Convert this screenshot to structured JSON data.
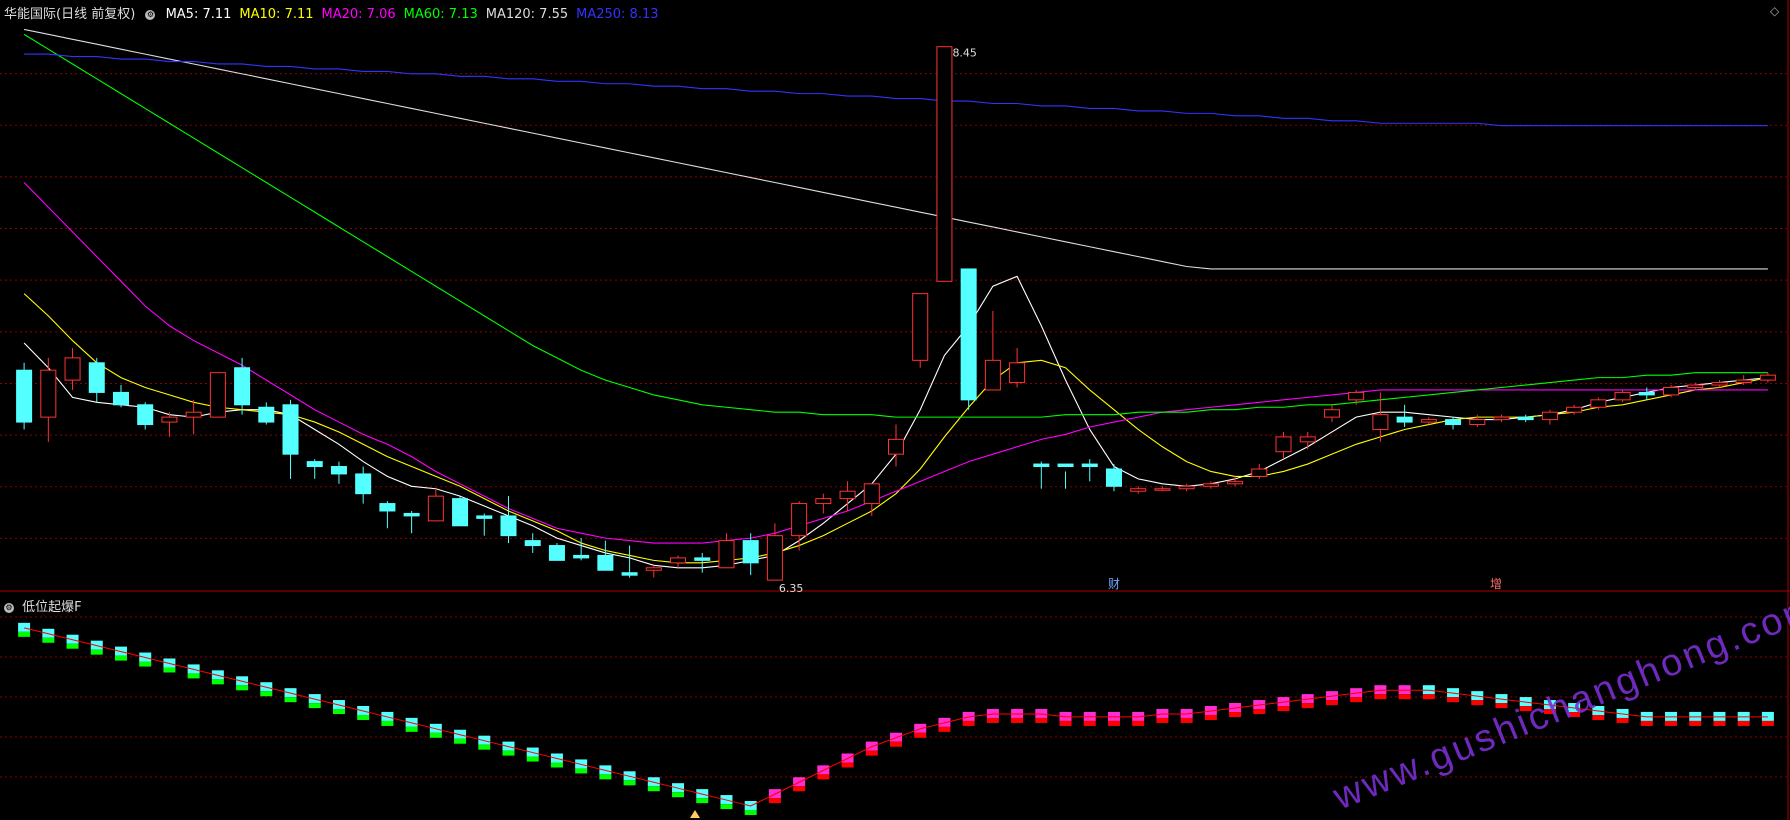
{
  "header": {
    "stock": "华能国际(日线 前复权)",
    "ma_labels": [
      {
        "name": "MA5",
        "text": "MA5: 7.11",
        "color": "#ffffff"
      },
      {
        "name": "MA10",
        "text": "MA10: 7.11",
        "color": "#ffff00"
      },
      {
        "name": "MA20",
        "text": "MA20: 7.06",
        "color": "#ff00ff"
      },
      {
        "name": "MA60",
        "text": "MA60: 7.13",
        "color": "#00ff00"
      },
      {
        "name": "MA120",
        "text": "MA120: 7.55",
        "color": "#dddddd"
      },
      {
        "name": "MA250",
        "text": "MA250: 8.13",
        "color": "#3333ff"
      }
    ]
  },
  "indicator": {
    "title": "低位起爆F"
  },
  "watermark": "www.gushichanghong.com",
  "annotations": {
    "high_label": "8.45",
    "low_label": "6.35",
    "event1": "财",
    "event2": "增"
  },
  "colors": {
    "up": "#ff3232",
    "down": "#54ffff",
    "grid": "#8b0000",
    "bg": "#000000"
  },
  "chart_data": {
    "type": "candlestick",
    "ylim": [
      6.25,
      8.55
    ],
    "candles": [
      [
        7.14,
        6.93,
        7.17,
        6.9
      ],
      [
        6.95,
        7.14,
        7.19,
        6.85
      ],
      [
        7.1,
        7.19,
        7.23,
        7.06
      ],
      [
        7.17,
        7.05,
        7.19,
        7.01
      ],
      [
        7.05,
        7.0,
        7.08,
        6.99
      ],
      [
        7.0,
        6.92,
        7.01,
        6.9
      ],
      [
        6.93,
        6.95,
        6.97,
        6.87
      ],
      [
        6.95,
        6.97,
        7.02,
        6.88
      ],
      [
        6.95,
        7.13,
        7.13,
        6.95
      ],
      [
        7.15,
        7.0,
        7.19,
        6.96
      ],
      [
        6.99,
        6.93,
        7.01,
        6.92
      ],
      [
        7.0,
        6.8,
        7.02,
        6.7
      ],
      [
        6.77,
        6.75,
        6.78,
        6.7
      ],
      [
        6.75,
        6.72,
        6.77,
        6.68
      ],
      [
        6.72,
        6.64,
        6.75,
        6.6
      ],
      [
        6.6,
        6.57,
        6.61,
        6.5
      ],
      [
        6.56,
        6.55,
        6.57,
        6.48
      ],
      [
        6.53,
        6.63,
        6.66,
        6.53
      ],
      [
        6.62,
        6.51,
        6.63,
        6.51
      ],
      [
        6.55,
        6.54,
        6.56,
        6.47
      ],
      [
        6.55,
        6.47,
        6.63,
        6.44
      ],
      [
        6.45,
        6.43,
        6.48,
        6.4
      ],
      [
        6.43,
        6.37,
        6.44,
        6.38
      ],
      [
        6.39,
        6.38,
        6.46,
        6.37
      ],
      [
        6.39,
        6.33,
        6.45,
        6.38
      ],
      [
        6.32,
        6.31,
        6.43,
        6.3
      ],
      [
        6.33,
        6.34,
        6.35,
        6.3
      ],
      [
        6.36,
        6.38,
        6.39,
        6.34
      ],
      [
        6.38,
        6.37,
        6.4,
        6.32
      ],
      [
        6.34,
        6.45,
        6.48,
        6.34
      ],
      [
        6.45,
        6.36,
        6.48,
        6.31
      ],
      [
        6.29,
        6.47,
        6.52,
        6.29
      ],
      [
        6.47,
        6.6,
        6.61,
        6.41
      ],
      [
        6.6,
        6.62,
        6.64,
        6.56
      ],
      [
        6.62,
        6.65,
        6.69,
        6.57
      ],
      [
        6.6,
        6.68,
        6.68,
        6.55
      ],
      [
        6.8,
        6.86,
        6.92,
        6.75
      ],
      [
        7.18,
        7.45,
        7.4,
        7.15
      ],
      [
        7.5,
        8.45,
        8.45,
        7.9
      ],
      [
        7.55,
        7.02,
        7.55,
        6.98
      ],
      [
        7.06,
        7.18,
        7.38,
        7.06
      ],
      [
        7.09,
        7.17,
        7.23,
        7.07
      ],
      [
        6.76,
        6.75,
        6.77,
        6.66
      ],
      [
        6.76,
        6.75,
        6.73,
        6.66
      ],
      [
        6.76,
        6.75,
        6.78,
        6.69
      ],
      [
        6.74,
        6.67,
        6.76,
        6.65
      ],
      [
        6.65,
        6.66,
        6.67,
        6.64
      ],
      [
        6.66,
        6.66,
        6.67,
        6.65
      ],
      [
        6.66,
        6.67,
        6.68,
        6.65
      ],
      [
        6.67,
        6.68,
        6.69,
        6.66
      ],
      [
        6.68,
        6.69,
        6.71,
        6.67
      ],
      [
        6.71,
        6.74,
        6.76,
        6.7
      ],
      [
        6.81,
        6.87,
        6.89,
        6.78
      ],
      [
        6.85,
        6.87,
        6.89,
        6.82
      ],
      [
        6.95,
        6.98,
        7.0,
        6.93
      ],
      [
        7.02,
        7.05,
        7.06,
        7.0
      ],
      [
        6.9,
        6.96,
        7.05,
        6.85
      ],
      [
        6.95,
        6.93,
        7.0,
        6.91
      ],
      [
        6.93,
        6.94,
        6.95,
        6.92
      ],
      [
        6.94,
        6.92,
        6.95,
        6.9
      ],
      [
        6.92,
        6.94,
        6.96,
        6.91
      ],
      [
        6.94,
        6.95,
        6.96,
        6.93
      ],
      [
        6.95,
        6.94,
        6.96,
        6.93
      ],
      [
        6.94,
        6.97,
        6.98,
        6.92
      ],
      [
        6.97,
        6.99,
        7.0,
        6.96
      ],
      [
        6.99,
        7.02,
        7.03,
        6.98
      ],
      [
        7.02,
        7.05,
        7.06,
        7.01
      ],
      [
        7.05,
        7.04,
        7.07,
        7.02
      ],
      [
        7.04,
        7.07,
        7.08,
        7.03
      ],
      [
        7.07,
        7.08,
        7.09,
        7.06
      ],
      [
        7.08,
        7.09,
        7.1,
        7.07
      ],
      [
        7.09,
        7.1,
        7.12,
        7.08
      ],
      [
        7.1,
        7.12,
        7.13,
        7.09
      ]
    ],
    "ma": {
      "MA5": [
        7.25,
        7.15,
        7.03,
        7.01,
        7.0,
        6.99,
        6.96,
        6.95,
        6.97,
        6.98,
        6.98,
        6.96,
        6.9,
        6.84,
        6.77,
        6.71,
        6.67,
        6.66,
        6.63,
        6.59,
        6.55,
        6.51,
        6.46,
        6.43,
        6.4,
        6.38,
        6.35,
        6.34,
        6.34,
        6.35,
        6.37,
        6.39,
        6.45,
        6.52,
        6.6,
        6.68,
        6.8,
        6.98,
        7.2,
        7.32,
        7.48,
        7.52,
        7.32,
        7.1,
        6.9,
        6.75,
        6.7,
        6.68,
        6.67,
        6.68,
        6.7,
        6.73,
        6.78,
        6.83,
        6.89,
        6.95,
        6.97,
        6.97,
        6.96,
        6.95,
        6.94,
        6.94,
        6.95,
        6.96,
        6.98,
        7.01,
        7.03,
        7.05,
        7.07,
        7.08,
        7.09,
        7.1,
        7.11
      ],
      "MA10": [
        7.45,
        7.36,
        7.26,
        7.17,
        7.11,
        7.07,
        7.04,
        7.01,
        6.99,
        6.98,
        6.97,
        6.96,
        6.93,
        6.89,
        6.84,
        6.79,
        6.75,
        6.71,
        6.67,
        6.62,
        6.57,
        6.53,
        6.49,
        6.44,
        6.41,
        6.39,
        6.37,
        6.36,
        6.36,
        6.37,
        6.38,
        6.4,
        6.43,
        6.47,
        6.52,
        6.57,
        6.64,
        6.74,
        6.87,
        6.99,
        7.1,
        7.17,
        7.18,
        7.15,
        7.06,
        6.98,
        6.9,
        6.83,
        6.77,
        6.73,
        6.71,
        6.71,
        6.73,
        6.76,
        6.8,
        6.84,
        6.87,
        6.9,
        6.92,
        6.94,
        6.95,
        6.95,
        6.95,
        6.96,
        6.97,
        6.99,
        7.0,
        7.02,
        7.04,
        7.06,
        7.07,
        7.09,
        7.11
      ],
      "MA20": [
        7.9,
        7.8,
        7.7,
        7.6,
        7.5,
        7.4,
        7.32,
        7.26,
        7.21,
        7.16,
        7.1,
        7.04,
        6.98,
        6.93,
        6.88,
        6.84,
        6.79,
        6.73,
        6.68,
        6.63,
        6.58,
        6.54,
        6.5,
        6.48,
        6.46,
        6.45,
        6.44,
        6.44,
        6.44,
        6.45,
        6.46,
        6.48,
        6.51,
        6.54,
        6.57,
        6.61,
        6.65,
        6.69,
        6.73,
        6.77,
        6.8,
        6.83,
        6.86,
        6.88,
        6.91,
        6.93,
        6.95,
        6.97,
        6.98,
        6.99,
        7.0,
        7.01,
        7.02,
        7.03,
        7.04,
        7.05,
        7.06,
        7.06,
        7.06,
        7.06,
        7.06,
        7.06,
        7.06,
        7.06,
        7.06,
        7.06,
        7.06,
        7.06,
        7.06,
        7.06,
        7.06,
        7.06,
        7.06
      ],
      "MA60": [
        8.5,
        8.44,
        8.38,
        8.32,
        8.26,
        8.2,
        8.14,
        8.08,
        8.02,
        7.96,
        7.9,
        7.84,
        7.78,
        7.72,
        7.66,
        7.6,
        7.54,
        7.48,
        7.42,
        7.36,
        7.3,
        7.24,
        7.19,
        7.14,
        7.1,
        7.07,
        7.04,
        7.02,
        7.0,
        6.99,
        6.98,
        6.97,
        6.97,
        6.96,
        6.96,
        6.96,
        6.95,
        6.95,
        6.95,
        6.95,
        6.95,
        6.95,
        6.95,
        6.96,
        6.96,
        6.96,
        6.97,
        6.97,
        6.97,
        6.98,
        6.98,
        6.99,
        6.99,
        7.0,
        7.0,
        7.01,
        7.02,
        7.03,
        7.04,
        7.05,
        7.06,
        7.07,
        7.08,
        7.09,
        7.1,
        7.11,
        7.11,
        7.12,
        7.12,
        7.13,
        7.13,
        7.13,
        7.13
      ],
      "MA120": [
        8.52,
        8.5,
        8.48,
        8.46,
        8.44,
        8.42,
        8.4,
        8.38,
        8.36,
        8.34,
        8.32,
        8.3,
        8.28,
        8.26,
        8.24,
        8.22,
        8.2,
        8.18,
        8.16,
        8.14,
        8.12,
        8.1,
        8.08,
        8.06,
        8.04,
        8.02,
        8.0,
        7.98,
        7.96,
        7.94,
        7.92,
        7.9,
        7.88,
        7.86,
        7.84,
        7.82,
        7.8,
        7.78,
        7.76,
        7.74,
        7.72,
        7.7,
        7.68,
        7.66,
        7.64,
        7.62,
        7.6,
        7.58,
        7.56,
        7.55,
        7.55,
        7.55,
        7.55,
        7.55,
        7.55,
        7.55,
        7.55,
        7.55,
        7.55,
        7.55,
        7.55,
        7.55,
        7.55,
        7.55,
        7.55,
        7.55,
        7.55,
        7.55,
        7.55,
        7.55,
        7.55,
        7.55,
        7.55
      ],
      "MA250": [
        8.42,
        8.42,
        8.41,
        8.41,
        8.4,
        8.4,
        8.39,
        8.39,
        8.38,
        8.38,
        8.37,
        8.37,
        8.36,
        8.36,
        8.35,
        8.35,
        8.34,
        8.34,
        8.33,
        8.33,
        8.32,
        8.32,
        8.31,
        8.31,
        8.3,
        8.3,
        8.29,
        8.29,
        8.28,
        8.28,
        8.27,
        8.27,
        8.26,
        8.26,
        8.25,
        8.25,
        8.24,
        8.24,
        8.23,
        8.23,
        8.22,
        8.22,
        8.21,
        8.21,
        8.2,
        8.2,
        8.19,
        8.19,
        8.18,
        8.18,
        8.17,
        8.17,
        8.16,
        8.16,
        8.15,
        8.15,
        8.14,
        8.14,
        8.14,
        8.14,
        8.14,
        8.13,
        8.13,
        8.13,
        8.13,
        8.13,
        8.13,
        8.13,
        8.13,
        8.13,
        8.13,
        8.13,
        8.13
      ]
    },
    "indicator_values": [
      6.0,
      5.8,
      5.6,
      5.4,
      5.2,
      5.0,
      4.8,
      4.6,
      4.4,
      4.2,
      4.0,
      3.8,
      3.6,
      3.4,
      3.2,
      3.0,
      2.8,
      2.6,
      2.4,
      2.2,
      2.0,
      1.8,
      1.6,
      1.4,
      1.2,
      1.0,
      0.8,
      0.6,
      0.4,
      0.2,
      0.0,
      0.4,
      0.8,
      1.2,
      1.6,
      2.0,
      2.3,
      2.6,
      2.8,
      3.0,
      3.1,
      3.1,
      3.1,
      3.0,
      3.0,
      3.0,
      3.0,
      3.1,
      3.1,
      3.2,
      3.3,
      3.4,
      3.5,
      3.6,
      3.7,
      3.8,
      3.9,
      3.9,
      3.9,
      3.8,
      3.7,
      3.6,
      3.5,
      3.4,
      3.3,
      3.2,
      3.1,
      3.0,
      3.0,
      3.0,
      3.0,
      3.0,
      3.0
    ]
  }
}
